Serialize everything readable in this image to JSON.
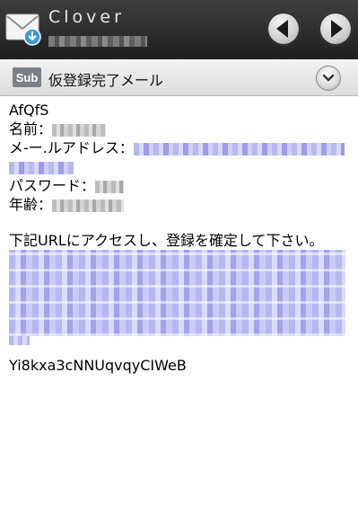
{
  "header": {
    "title": "Clover",
    "icons": {
      "app": "mail-envelope-icon",
      "prev": "arrow-left-icon",
      "next": "arrow-right-icon"
    }
  },
  "subject": {
    "badge": "Sub",
    "text": "仮登録完了メール",
    "expand_icon": "chevron-down-icon"
  },
  "message": {
    "greeting": "AfQfS",
    "name_label": "名前：",
    "email_label": "メ-ー.ルアドレス：",
    "password_label": "パスワード：",
    "age_label": "年齢：",
    "instruction": "下記URLにアクセスし、登録を確定して下さい。",
    "code": "Yi8kxa3cNNUqvqyCIWeB"
  },
  "colors": {
    "header_bg": "#2b2b2b",
    "subject_bg": "#e6e6e6",
    "badge_bg": "#7b7f86",
    "link": "#b6b6f1"
  }
}
